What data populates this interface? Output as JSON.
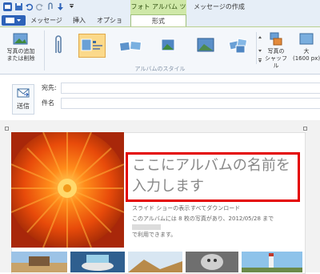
{
  "quick_access": {
    "icons": [
      "app-icon",
      "save-icon",
      "undo-icon",
      "redo-icon",
      "attach-icon",
      "send-icon",
      "customize-icon"
    ]
  },
  "window": {
    "contextual_tab_label": "フォト アルバム ツール",
    "title": "メッセージの作成"
  },
  "tabs": {
    "message": "メッセージ",
    "insert": "挿入",
    "options": "オプション",
    "format": "形式"
  },
  "ribbon": {
    "add_remove_label_1": "写真の追加",
    "add_remove_label_2": "または削除",
    "group_label": "アルバムのスタイル",
    "shuffle_label_1": "写真の",
    "shuffle_label_2": "シャッフル",
    "size_label_1": "大",
    "size_label_2": "(1600 px)"
  },
  "compose": {
    "send_label": "送信",
    "to_label": "宛先:",
    "subject_label": "件名"
  },
  "album": {
    "title": "ここにアルバムの名前を入力します",
    "slideshow_link": "スライド ショーの表示",
    "download_all_link": "すべてダウンロード",
    "info_part1": "このアルバムには 8 枚の写真があり、2012/05/28 まで",
    "info_part2": "で利用できます。"
  },
  "colors": {
    "ribbon_accent": "#cfe8a8",
    "highlight_border": "#e40000",
    "selected_style": "#fbd98a"
  }
}
